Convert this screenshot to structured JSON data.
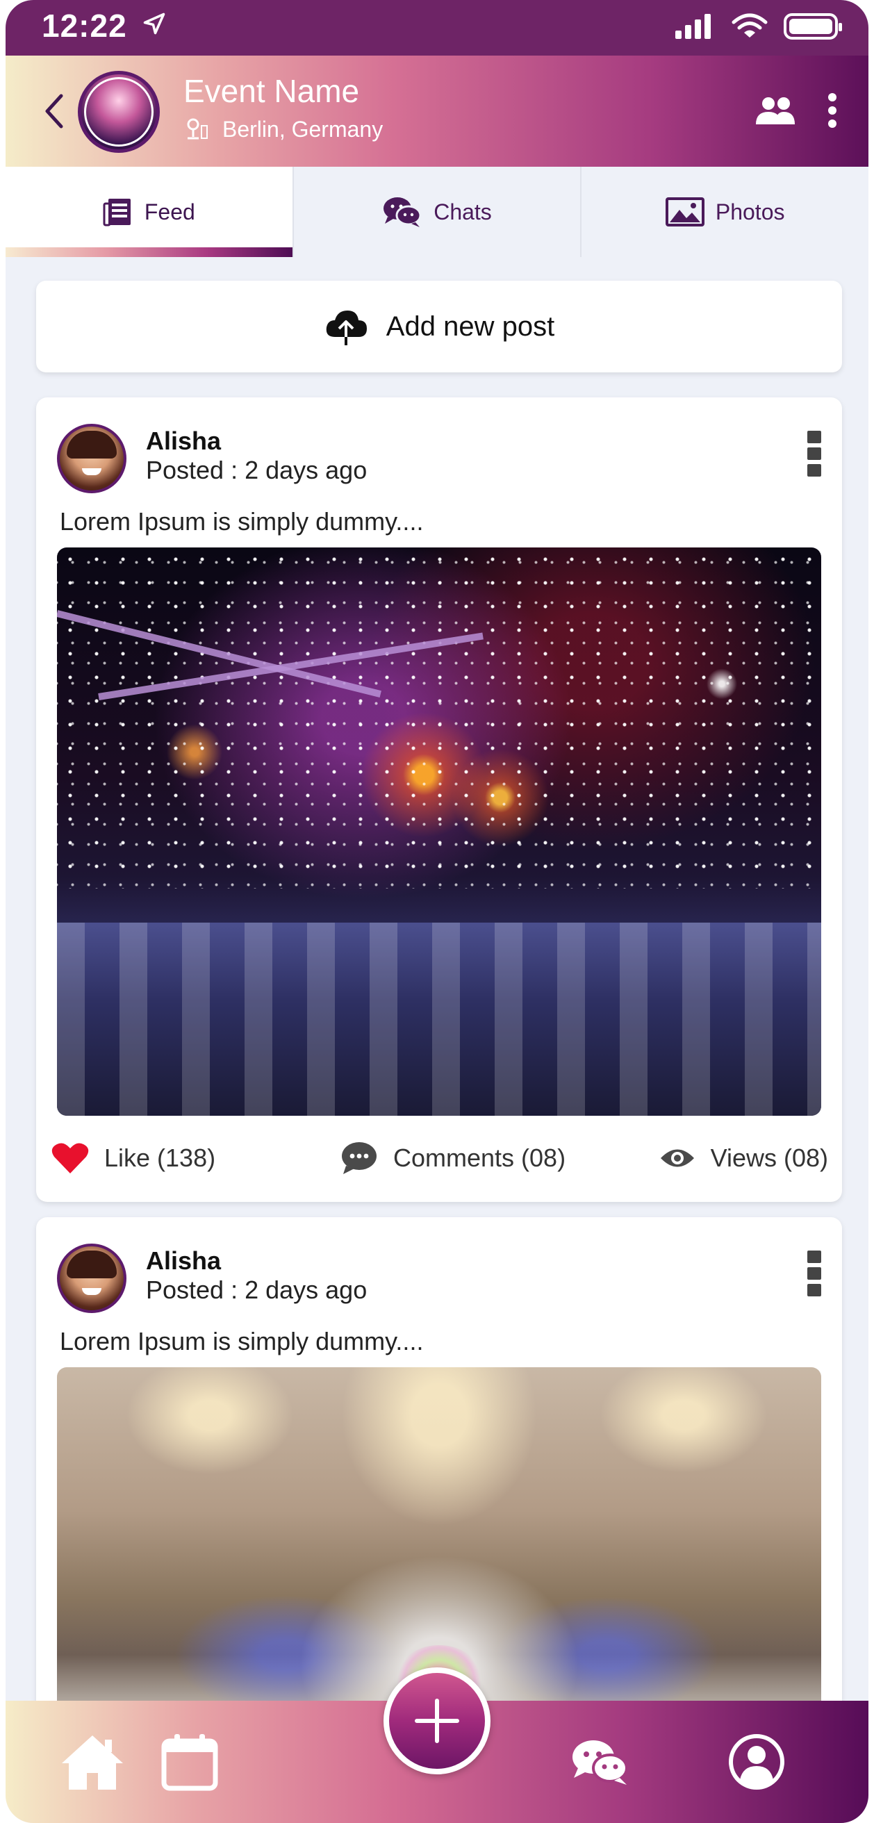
{
  "status_bar": {
    "time": "12:22"
  },
  "header": {
    "event_name": "Event Name",
    "location": "Berlin, Germany"
  },
  "tabs": [
    {
      "label": "Feed",
      "icon": "feed-icon",
      "active": true
    },
    {
      "label": "Chats",
      "icon": "chats-icon",
      "active": false
    },
    {
      "label": "Photos",
      "icon": "photos-icon",
      "active": false
    }
  ],
  "add_post": {
    "label": "Add new post"
  },
  "posts": [
    {
      "author": "Alisha",
      "time": "Posted : 2 days ago",
      "text": "Lorem Ipsum is simply dummy....",
      "likes": "Like (138)",
      "comments": "Comments (08)",
      "views": "Views (08)"
    },
    {
      "author": "Alisha",
      "time": "Posted : 2 days ago",
      "text": "Lorem Ipsum is simply dummy...."
    }
  ],
  "bottom_nav": {
    "items": [
      "home-icon",
      "calendar-icon",
      "add-icon",
      "chat-icon",
      "profile-icon"
    ]
  },
  "colors": {
    "accent_dark": "#5c1059",
    "accent_pink": "#d57094",
    "accent_cream": "#f5ecc9",
    "like_red": "#e8112d"
  }
}
